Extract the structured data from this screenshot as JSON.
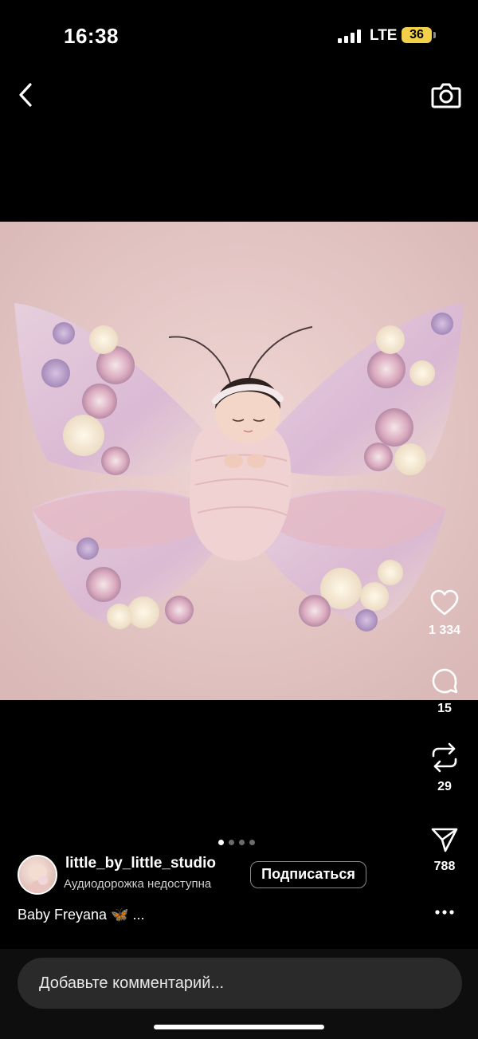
{
  "status_bar": {
    "time": "16:38",
    "network": "LTE",
    "battery": "36"
  },
  "nav": {
    "back_icon": "chevron-left-icon",
    "camera_icon": "camera-icon"
  },
  "post": {
    "media_icon": "photo-newborn-butterfly",
    "page_indicator": {
      "total": 4,
      "active": 1
    }
  },
  "actions": {
    "likes": "1 334",
    "comments": "15",
    "reposts": "29",
    "shares": "788"
  },
  "author": {
    "username": "little_by_little_studio",
    "audio": "Аудиодорожка недоступна",
    "follow_label": "Подписаться"
  },
  "caption": {
    "text": "Baby Freyana",
    "emoji": "🦋",
    "more": "..."
  },
  "comment": {
    "placeholder": "Добавьте комментарий..."
  },
  "colors": {
    "background": "#000000",
    "battery": "#f2d04a",
    "photo_backdrop": "#e6c9c8"
  }
}
